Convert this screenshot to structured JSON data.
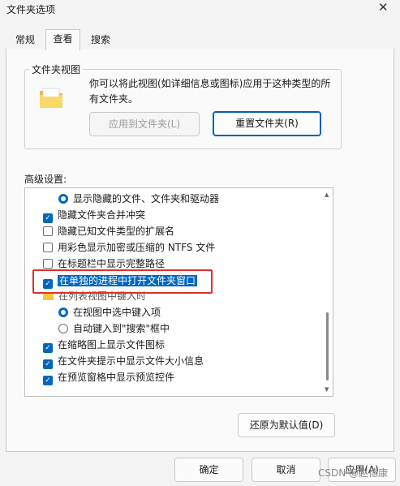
{
  "window": {
    "title": "文件夹选项"
  },
  "tabs": [
    {
      "label": "常规"
    },
    {
      "label": "查看"
    },
    {
      "label": "搜索"
    }
  ],
  "folder_views": {
    "group_title": "文件夹视图",
    "description": "你可以将此视图(如详细信息或图标)应用于这种类型的所有文件夹。",
    "apply_button": "应用到文件夹(L)",
    "reset_button": "重置文件夹(R)"
  },
  "advanced": {
    "label": "高级设置:",
    "items": [
      {
        "label": "显示隐藏的文件、文件夹和驱动器",
        "type": "radio",
        "checked": true
      },
      {
        "label": "隐藏文件夹合并冲突",
        "type": "checkbox",
        "checked": true
      },
      {
        "label": "隐藏已知文件类型的扩展名",
        "type": "checkbox",
        "checked": false
      },
      {
        "label": "用彩色显示加密或压缩的 NTFS 文件",
        "type": "checkbox",
        "checked": false
      },
      {
        "label": "在标题栏中显示完整路径",
        "type": "checkbox",
        "checked": false
      },
      {
        "label": "在单独的进程中打开文件夹窗口",
        "type": "checkbox",
        "checked": true,
        "selected": true
      },
      {
        "label": "在列表视图中键入时",
        "type": "folder"
      },
      {
        "label": "在视图中选中键入项",
        "type": "radio",
        "checked": true
      },
      {
        "label": "自动键入到\"搜索\"框中",
        "type": "radio",
        "checked": false
      },
      {
        "label": "在缩略图上显示文件图标",
        "type": "checkbox",
        "checked": true
      },
      {
        "label": "在文件夹提示中显示文件大小信息",
        "type": "checkbox",
        "checked": true
      },
      {
        "label": "在预览窗格中显示预览控件",
        "type": "checkbox",
        "checked": true
      }
    ],
    "restore_button": "还原为默认值(D)"
  },
  "footer": {
    "ok": "确定",
    "cancel": "取消",
    "apply": "应用(A)",
    "watermark": "CSDN @赵德康"
  },
  "colors": {
    "accent": "#0067c0",
    "highlight_box": "#e0302a"
  }
}
